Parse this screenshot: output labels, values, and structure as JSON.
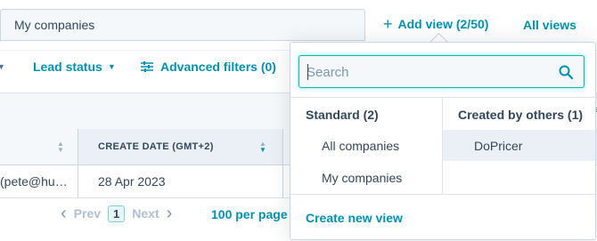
{
  "tabs": {
    "current": "My companies",
    "add_view_label": "Add view (2/50)",
    "all_views_label": "All views"
  },
  "filters": {
    "lead_status_label": "Lead status",
    "advanced_filters_label": "Advanced filters (0)"
  },
  "table": {
    "columns": [
      "",
      "CREATE DATE (GMT+2)"
    ],
    "rows": [
      [
        "(pete@hu…",
        "28 Apr 2023"
      ]
    ]
  },
  "pagination": {
    "prev_label": "Prev",
    "current_page": "1",
    "next_label": "Next",
    "per_page_label": "100 per page"
  },
  "view_picker": {
    "search_placeholder": "Search",
    "standard_heading": "Standard (2)",
    "standard_views": [
      "All companies",
      "My companies"
    ],
    "others_heading": "Created by others (1)",
    "others_views": [
      "DoPricer"
    ],
    "create_new_label": "Create new view"
  },
  "colors": {
    "accent": "#0091ae",
    "text": "#33475b",
    "focus_border": "#00bda5",
    "hover_bg": "#eaf0f6"
  }
}
